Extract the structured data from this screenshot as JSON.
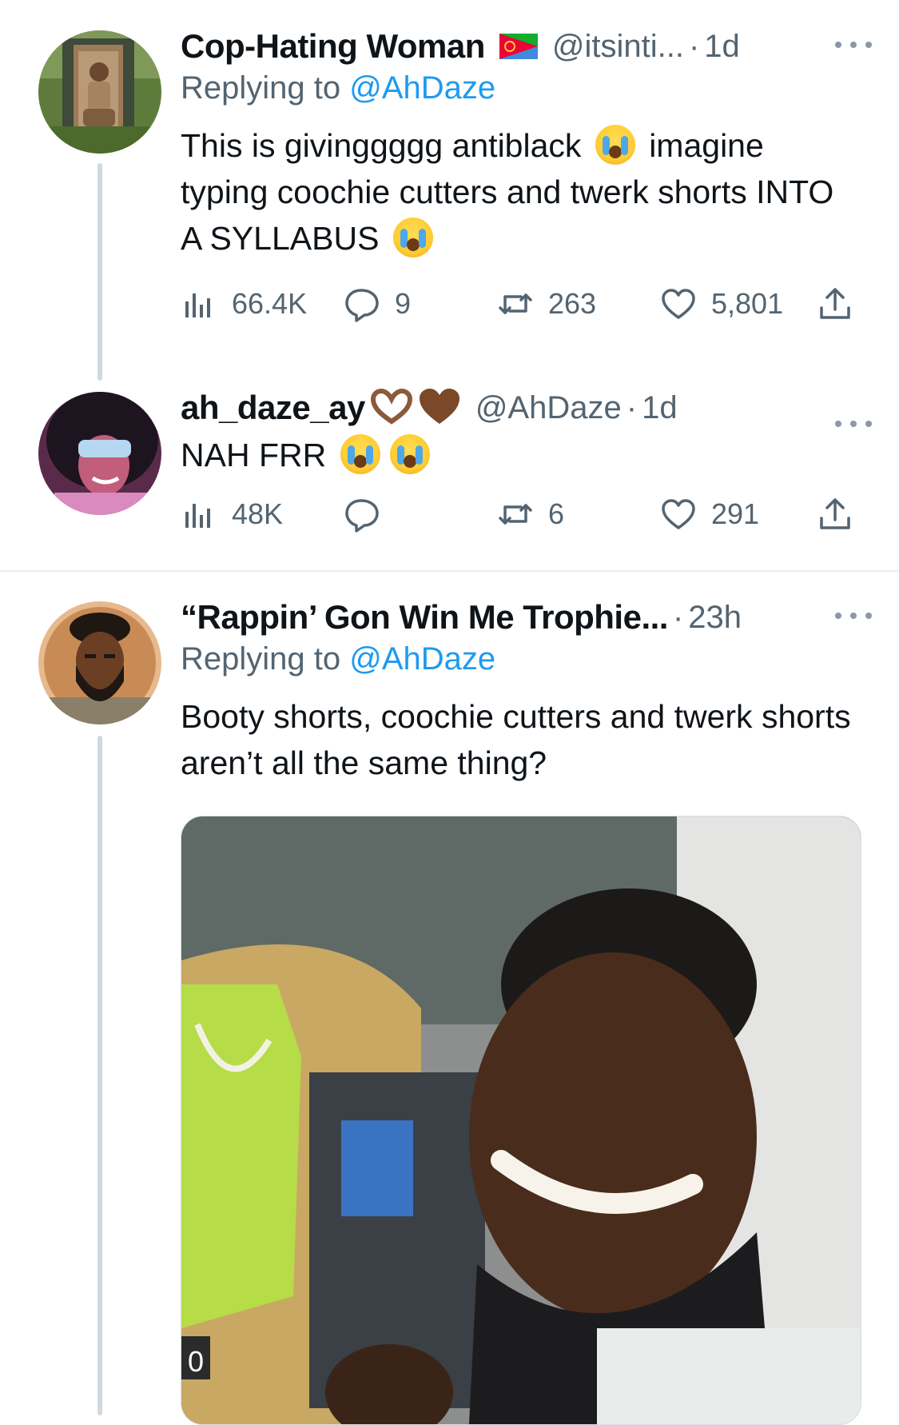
{
  "tweets": [
    {
      "display_name": "Cop-Hating Woman",
      "handle": "@itsinti...",
      "dot": "·",
      "time": "1d",
      "replying_prefix": "Replying to ",
      "replying_to": "@AhDaze",
      "text_parts": [
        "This is givinggggg antiblack",
        "imagine typing coochie cutters and twerk shorts INTO A SYLLABUS"
      ],
      "views": "66.4K",
      "replies": "9",
      "retweets": "263",
      "likes": "5,801"
    },
    {
      "display_name": "ah_daze_ay",
      "handle": "@AhDaze",
      "dot": "·",
      "time": "1d",
      "text": "NAH FRR",
      "views": "48K",
      "replies": "",
      "retweets": "6",
      "likes": "291"
    },
    {
      "display_name": "“Rappin’ Gon Win Me Trophie...",
      "dot": "·",
      "time": "23h",
      "replying_prefix": "Replying to ",
      "replying_to": "@AhDaze",
      "text": "Booty shorts, coochie cutters and twerk shorts aren’t all the same thing?"
    }
  ],
  "media": {
    "corner_label": "0"
  },
  "colors": {
    "accent": "#1d9bf0",
    "muted": "#536471",
    "thread_line": "#cfd9de"
  },
  "icons": [
    "views-icon",
    "reply-icon",
    "retweet-icon",
    "like-icon",
    "share-icon",
    "more-icon",
    "flag-icon",
    "loudly-crying-face-emoji",
    "hand-heart-emoji",
    "brown-heart-emoji"
  ]
}
